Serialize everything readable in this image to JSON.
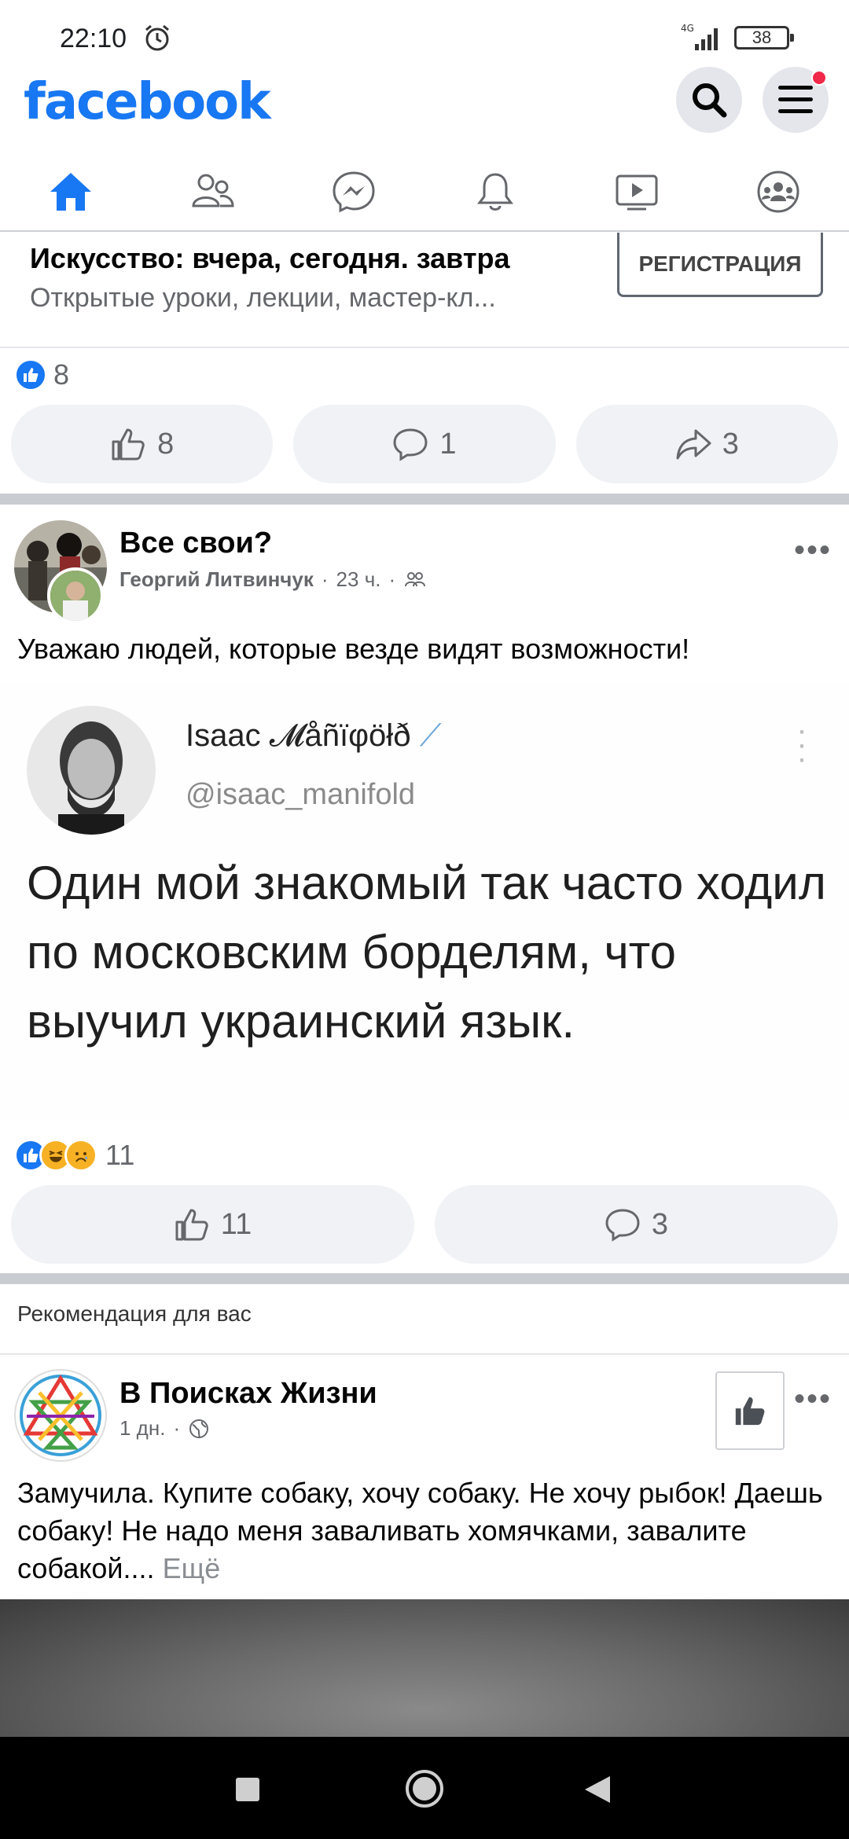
{
  "status_bar": {
    "time": "22:10",
    "network": "4G",
    "battery": "38"
  },
  "header": {
    "logo": "facebook",
    "search_icon": "search-icon",
    "menu_icon": "menu-icon"
  },
  "nav_tabs": [
    {
      "name": "home",
      "icon": "home-icon",
      "active": true
    },
    {
      "name": "friends",
      "icon": "friends-icon",
      "active": false
    },
    {
      "name": "messenger",
      "icon": "messenger-icon",
      "active": false
    },
    {
      "name": "notifications",
      "icon": "bell-icon",
      "active": false
    },
    {
      "name": "watch",
      "icon": "video-icon",
      "active": false
    },
    {
      "name": "groups",
      "icon": "groups-icon",
      "active": false
    }
  ],
  "ad": {
    "title": "Искусство: вчера, сегодня. завтра",
    "subtitle": "Открытые уроки, лекции, мастер-кл...",
    "register_label": "РЕГИСТРАЦИЯ",
    "reaction_count": "8",
    "actions": {
      "like_count": "8",
      "comment_count": "1",
      "share_count": "3"
    }
  },
  "post1": {
    "group_name": "Все свои?",
    "author": "Георгий Литвинчук",
    "time": "23 ч.",
    "separator": "·",
    "text": "Уважаю людей, которые везде видят возможности!",
    "tweet": {
      "name": "Isaac 𝓜åñïφöłð",
      "handle": "@isaac_manifold",
      "body": "Один мой знакомый так часто ходил по московским борделям, что выучил украинский язык."
    },
    "reaction_count": "11",
    "actions": {
      "like_count": "11",
      "comment_count": "3"
    }
  },
  "recommendation": {
    "label": "Рекомендация для вас",
    "page_name": "В Поисках Жизни",
    "time": "1 дн.",
    "separator": "·",
    "text": "Замучила. Купите собаку, хочу собаку. Не хочу рыбок! Даешь собаку! Не надо меня заваливать хомячками, завалите собакой....",
    "more_label": "Ещё"
  },
  "colors": {
    "brand": "#1877f2",
    "muted": "#65676b",
    "notification": "#f02849"
  }
}
